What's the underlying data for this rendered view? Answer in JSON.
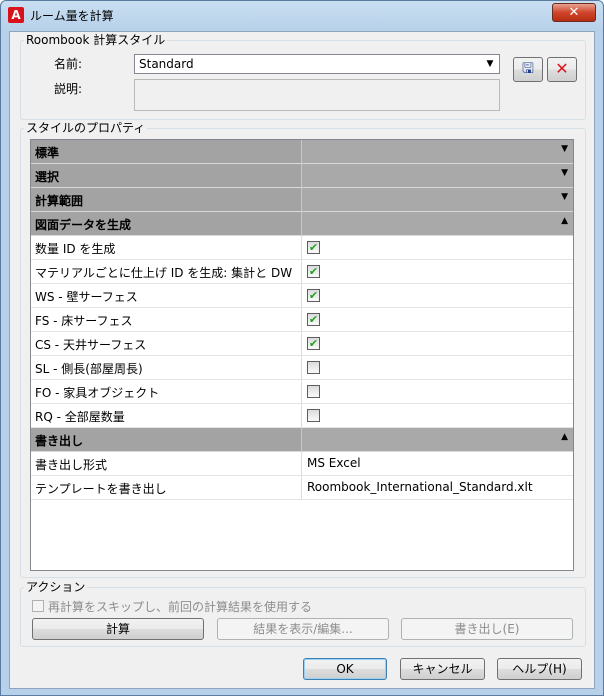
{
  "window": {
    "title": "ルーム量を計算",
    "close_glyph": "✕",
    "app_icon": "autocad-a-icon"
  },
  "style_group": {
    "label": "Roombook 計算スタイル",
    "name_label": "名前:",
    "name_value": "Standard",
    "desc_label": "説明:",
    "desc_value": "",
    "save_icon": "save-style-icon",
    "delete_icon": "delete-style-icon"
  },
  "properties": {
    "label": "スタイルのプロパティ",
    "rows": [
      {
        "type": "category",
        "name": "標準",
        "arrow": "▼"
      },
      {
        "type": "category",
        "name": "選択",
        "arrow": "▼"
      },
      {
        "type": "category",
        "name": "計算範囲",
        "arrow": "▼"
      },
      {
        "type": "category",
        "name": "図面データを生成",
        "arrow": "▲"
      },
      {
        "type": "check",
        "name": "数量 ID を生成",
        "checked": true
      },
      {
        "type": "check",
        "name": "マテリアルごとに仕上げ ID を生成: 集計と DW",
        "checked": true
      },
      {
        "type": "check",
        "name": "WS - 壁サーフェス",
        "checked": true
      },
      {
        "type": "check",
        "name": "FS - 床サーフェス",
        "checked": true
      },
      {
        "type": "check",
        "name": "CS - 天井サーフェス",
        "checked": true
      },
      {
        "type": "check",
        "name": "SL - 側長(部屋周長)",
        "checked": false
      },
      {
        "type": "check",
        "name": "FO - 家具オブジェクト",
        "checked": false
      },
      {
        "type": "check",
        "name": "RQ - 全部屋数量",
        "checked": false
      },
      {
        "type": "category",
        "name": "書き出し",
        "arrow": "▲"
      },
      {
        "type": "text",
        "name": "書き出し形式",
        "value": "MS Excel"
      },
      {
        "type": "text",
        "name": "テンプレートを書き出し",
        "value": "Roombook_International_Standard.xlt"
      }
    ]
  },
  "actions": {
    "label": "アクション",
    "skip_checkbox_label": "再計算をスキップし、前回の計算結果を使用する",
    "calc_button": "計算",
    "show_edit_button": "結果を表示/編集...",
    "export_button": "書き出し(E)"
  },
  "footer": {
    "ok": "OK",
    "cancel": "キャンセル",
    "help": "ヘルプ(H)"
  }
}
